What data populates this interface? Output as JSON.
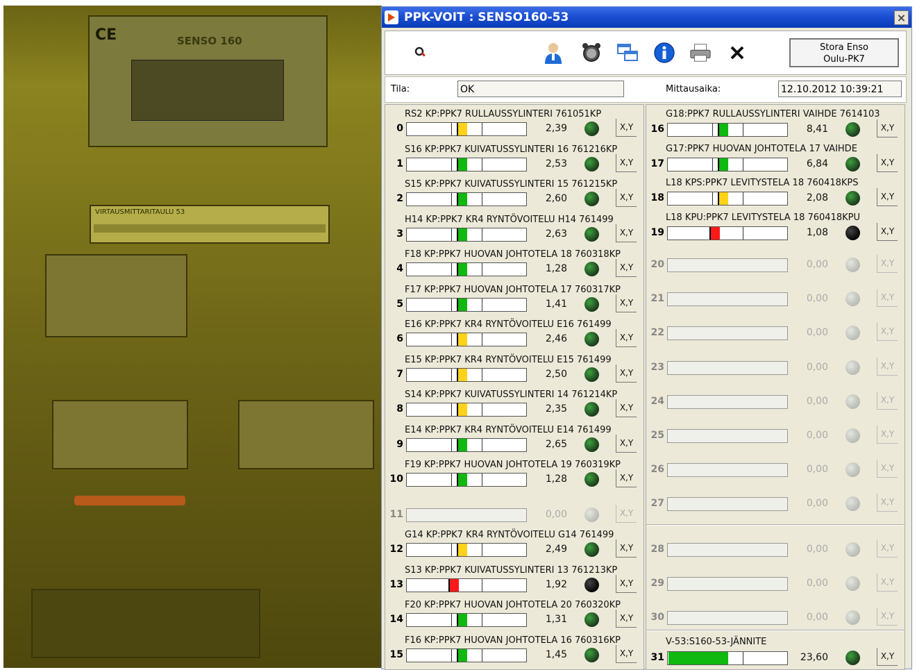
{
  "window": {
    "title": "PPK-VOIT : SENSO160-53",
    "close_label": "×"
  },
  "toolbar": {
    "icons": [
      "magnifier-icon",
      "user-icon",
      "alarm-icon",
      "windows-icon",
      "info-icon",
      "printer-icon",
      "close-x-icon"
    ],
    "company_line1": "Stora Enso",
    "company_line2": "Oulu-PK7"
  },
  "status": {
    "tila_label": "Tila:",
    "tila_value": "OK",
    "mittausaika_label": "Mittausaika:",
    "mittausaika_value": "12.10.2012   10:39:21"
  },
  "xy_label": "X,Y",
  "photo": {
    "label_a": "SENSO 160",
    "label_b": "VIRTAUSMITTARITAULU  53",
    "label_c": "CE"
  },
  "colors": {
    "green": "#10b810",
    "yellow": "#ffd21a",
    "red": "#ff1a1a",
    "led_on": "#1c3a1c",
    "led_off": "#b8bcb4",
    "led_black": "#050505"
  },
  "left_rows": [
    {
      "idx": "0",
      "name": "RS2 KP:PPK7 RULLAUSSYLINTERI 761051KP",
      "value": "2,39",
      "level": 0.43,
      "color": "yellow",
      "led": "on",
      "active": true
    },
    {
      "idx": "1",
      "name": "S16 KP:PPK7 KUIVATUSSYLINTERI 16 761216KP",
      "value": "2,53",
      "level": 0.43,
      "color": "green",
      "led": "on",
      "active": true
    },
    {
      "idx": "2",
      "name": "S15 KP:PPK7 KUIVATUSSYLINTERI 15 761215KP",
      "value": "2,60",
      "level": 0.43,
      "color": "green",
      "led": "on",
      "active": true
    },
    {
      "idx": "3",
      "name": "H14 KP:PPK7 KR4   RYNTÖVOITELU H14 761499",
      "value": "2,63",
      "level": 0.43,
      "color": "green",
      "led": "on",
      "active": true
    },
    {
      "idx": "4",
      "name": "F18 KP:PPK7 HUOVAN JOHTOTELA 18 760318KP",
      "value": "1,28",
      "level": 0.43,
      "color": "green",
      "led": "on",
      "active": true
    },
    {
      "idx": "5",
      "name": "F17 KP:PPK7 HUOVAN JOHTOTELA 17 760317KP",
      "value": "1,41",
      "level": 0.43,
      "color": "green",
      "led": "on",
      "active": true
    },
    {
      "idx": "6",
      "name": "E16 KP:PPK7 KR4   RYNTÖVOITELU E16 761499",
      "value": "2,46",
      "level": 0.43,
      "color": "yellow",
      "led": "on",
      "active": true
    },
    {
      "idx": "7",
      "name": "E15 KP:PPK7 KR4   RYNTÖVOITELU E15 761499",
      "value": "2,50",
      "level": 0.43,
      "color": "yellow",
      "led": "on",
      "active": true
    },
    {
      "idx": "8",
      "name": "S14 KP:PPK7 KUIVATUSSYLINTERI 14 761214KP",
      "value": "2,35",
      "level": 0.43,
      "color": "yellow",
      "led": "on",
      "active": true
    },
    {
      "idx": "9",
      "name": "E14 KP:PPK7 KR4   RYNTÖVOITELU E14 761499",
      "value": "2,65",
      "level": 0.43,
      "color": "green",
      "led": "on",
      "active": true
    },
    {
      "idx": "10",
      "name": "F19 KP:PPK7 HUOVAN JOHTOTELA 19 760319KP",
      "value": "1,28",
      "level": 0.43,
      "color": "green",
      "led": "on",
      "active": true
    },
    {
      "idx": "11",
      "name": "",
      "value": "0,00",
      "level": 0,
      "color": "none",
      "led": "off",
      "active": false
    },
    {
      "idx": "12",
      "name": "G14 KP:PPK7 KR4   RYNTÖVOITELU G14 761499",
      "value": "2,49",
      "level": 0.43,
      "color": "yellow",
      "led": "on",
      "active": true
    },
    {
      "idx": "13",
      "name": "S13 KP:PPK7 KUIVATUSSYLINTERI 13 761213KP",
      "value": "1,92",
      "level": 0.36,
      "color": "red",
      "led": "black",
      "active": true
    },
    {
      "idx": "14",
      "name": "F20 KP:PPK7 HUOVAN JOHTOTELA 20 760320KP",
      "value": "1,31",
      "level": 0.43,
      "color": "green",
      "led": "on",
      "active": true
    },
    {
      "idx": "15",
      "name": "F16 KP:PPK7 HUOVAN JOHTOTELA 16 760316KP",
      "value": "1,45",
      "level": 0.43,
      "color": "green",
      "led": "on",
      "active": true
    }
  ],
  "right_rows": [
    {
      "idx": "16",
      "name": "G18:PPK7 RULLAUSSYLINTERI VAIHDE 7614103",
      "value": "8,41",
      "level": 0.43,
      "color": "green",
      "led": "on",
      "active": true
    },
    {
      "idx": "17",
      "name": "G17:PPK7 HUOVAN JOHTOTELA 17 VAIHDE",
      "value": "6,84",
      "level": 0.43,
      "color": "green",
      "led": "on",
      "active": true
    },
    {
      "idx": "18",
      "name": "L18 KPS:PPK7 LEVITYSTELA 18 760418KPS",
      "value": "2,08",
      "level": 0.43,
      "color": "yellow",
      "led": "on",
      "active": true
    },
    {
      "idx": "19",
      "name": "L18 KPU:PPK7 LEVITYSTELA 18 760418KPU",
      "value": "1,08",
      "level": 0.36,
      "color": "red",
      "led": "black",
      "active": true
    },
    {
      "idx": "20",
      "name": "",
      "value": "0,00",
      "level": 0,
      "color": "none",
      "led": "off",
      "active": false
    },
    {
      "idx": "21",
      "name": "",
      "value": "0,00",
      "level": 0,
      "color": "none",
      "led": "off",
      "active": false
    },
    {
      "idx": "22",
      "name": "",
      "value": "0,00",
      "level": 0,
      "color": "none",
      "led": "off",
      "active": false
    },
    {
      "idx": "23",
      "name": "",
      "value": "0,00",
      "level": 0,
      "color": "none",
      "led": "off",
      "active": false
    },
    {
      "idx": "24",
      "name": "",
      "value": "0,00",
      "level": 0,
      "color": "none",
      "led": "off",
      "active": false
    },
    {
      "idx": "25",
      "name": "",
      "value": "0,00",
      "level": 0,
      "color": "none",
      "led": "off",
      "active": false
    },
    {
      "idx": "26",
      "name": "",
      "value": "0,00",
      "level": 0,
      "color": "none",
      "led": "off",
      "active": false
    },
    {
      "idx": "27",
      "name": "",
      "value": "0,00",
      "level": 0,
      "color": "none",
      "led": "off",
      "active": false
    },
    {
      "idx": "28",
      "name": "",
      "value": "0,00",
      "level": 0,
      "color": "none",
      "led": "off",
      "active": false
    },
    {
      "idx": "29",
      "name": "",
      "value": "0,00",
      "level": 0,
      "color": "none",
      "led": "off",
      "active": false
    },
    {
      "idx": "30",
      "name": "",
      "value": "0,00",
      "level": 0,
      "color": "none",
      "led": "off",
      "active": false
    },
    {
      "idx": "31",
      "name": "V-53:S160-53-JÄNNITE",
      "value": "23,60",
      "level": 0.5,
      "color": "green",
      "led": "on",
      "active": true
    }
  ]
}
